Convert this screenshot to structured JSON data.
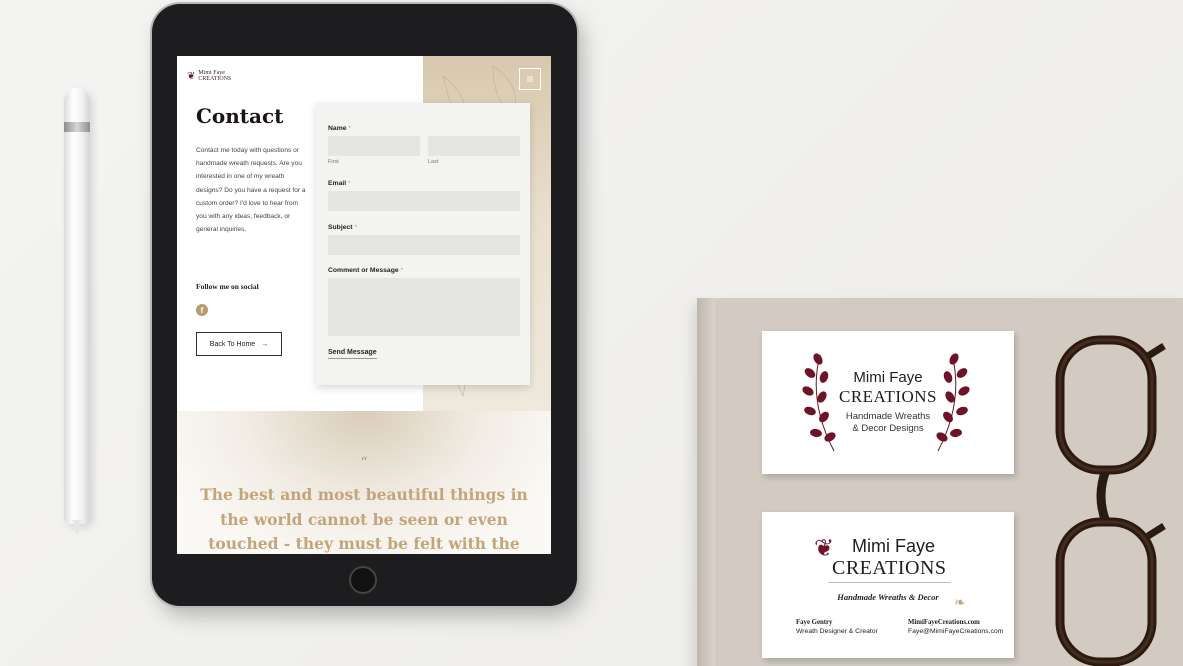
{
  "website": {
    "logo_line1": "Mimi Faye",
    "logo_line2": "CREATIONS",
    "menu_icon": "hamburger-icon",
    "title": "Contact",
    "intro": "Contact me today with questions or handmade wreath requests. Are you interested in one of my wreath designs? Do you have a request for a custom order? I'd love to hear from you with any ideas, feedback, or general inquiries.",
    "follow_label": "Follow me on social",
    "social_icon": "facebook-icon",
    "back_button": "Back To Home",
    "back_arrow": "→",
    "form": {
      "name_label": "Name",
      "required_mark": "*",
      "first_sub": "First",
      "last_sub": "Last",
      "email_label": "Email",
      "subject_label": "Subject",
      "comment_label": "Comment or Message",
      "send_button": "Send Message"
    },
    "quote_mark": "“",
    "quote_text": "The best and most beautiful things in the world cannot be seen or even touched - they must be felt with the"
  },
  "card_front": {
    "name": "Mimi Faye",
    "brand": "CREATIONS",
    "tagline_line1": "Handmade Wreaths",
    "tagline_line2": "& Decor Designs"
  },
  "card_back": {
    "name": "Mimi Faye",
    "brand": "CREATIONS",
    "tagline": "Handmade Wreaths & Decor",
    "person_name": "Faye Gentry",
    "person_role": "Wreath Designer & Creator",
    "website": "MimiFayeCreations.com",
    "email": "Faye@MimiFayeCreations.com"
  },
  "colors": {
    "accent_burgundy": "#6e1428",
    "accent_gold": "#c2a57a"
  }
}
